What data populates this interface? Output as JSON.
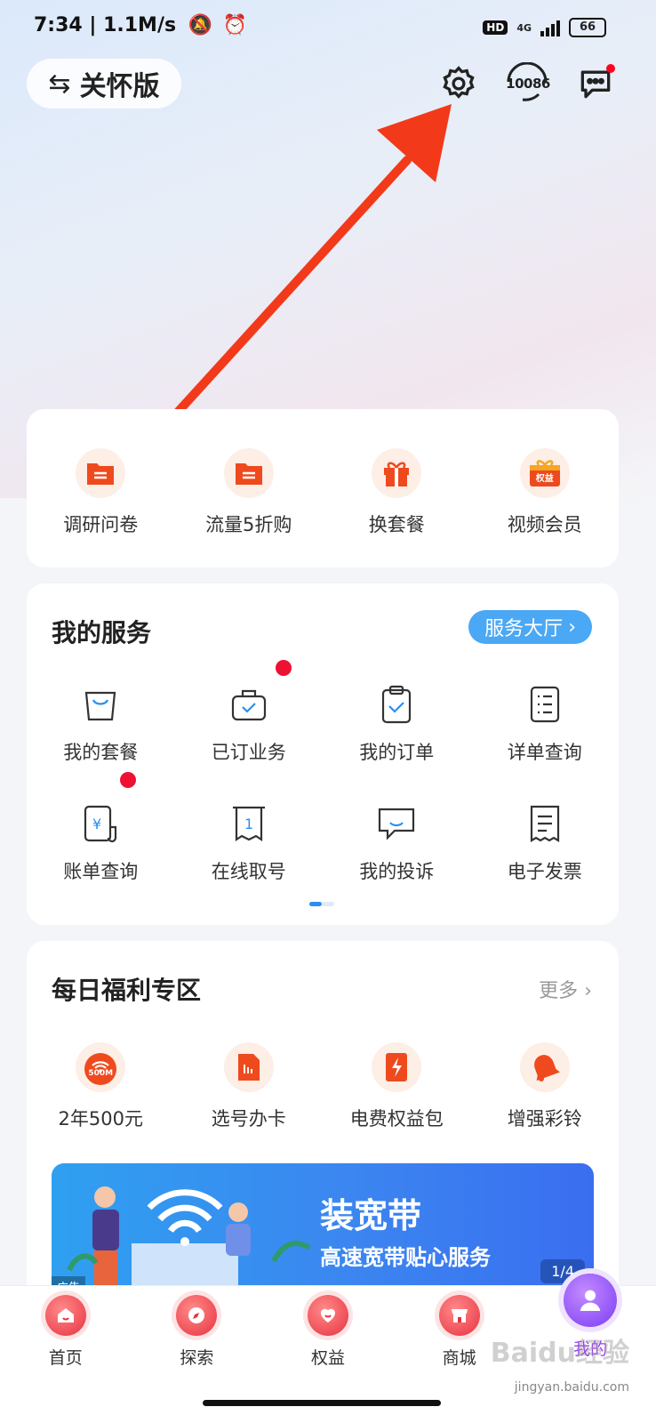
{
  "status_bar": {
    "time_speed": "7:34 | 1.1M/s",
    "network": "4G",
    "hd": "HD",
    "battery": "66"
  },
  "header": {
    "care_mode_label": "关怀版",
    "hotline_label": "10086",
    "icons": [
      "settings-icon",
      "customer-service-icon",
      "message-icon"
    ]
  },
  "quick_actions": [
    {
      "label": "调研问卷",
      "icon": "folder-icon"
    },
    {
      "label": "流量5折购",
      "icon": "folder-icon"
    },
    {
      "label": "换套餐",
      "icon": "gift-icon"
    },
    {
      "label": "视频会员",
      "icon": "gift-box-icon",
      "badge": "权益"
    }
  ],
  "services": {
    "title": "我的服务",
    "hall_button": "服务大厅",
    "items": [
      {
        "label": "我的套餐",
        "icon": "bag-icon",
        "dot": false
      },
      {
        "label": "已订业务",
        "icon": "briefcase-check-icon",
        "dot": true
      },
      {
        "label": "我的订单",
        "icon": "clipboard-check-icon",
        "dot": false
      },
      {
        "label": "详单查询",
        "icon": "list-doc-icon",
        "dot": false
      },
      {
        "label": "账单查询",
        "icon": "bill-icon",
        "dot": true
      },
      {
        "label": "在线取号",
        "icon": "ticket-icon",
        "dot": false
      },
      {
        "label": "我的投诉",
        "icon": "chat-icon",
        "dot": false
      },
      {
        "label": "电子发票",
        "icon": "invoice-icon",
        "dot": false
      }
    ],
    "pager": {
      "pages": 2,
      "active": 0
    }
  },
  "welfare": {
    "title": "每日福利专区",
    "more": "更多",
    "items": [
      {
        "label": "2年500元",
        "icon": "wifi-icon",
        "badge": "500M"
      },
      {
        "label": "选号办卡",
        "icon": "sim-card-icon"
      },
      {
        "label": "电费权益包",
        "icon": "electric-icon"
      },
      {
        "label": "增强彩铃",
        "icon": "bell-icon"
      }
    ],
    "banner": {
      "title": "装宽带",
      "subtitle": "高速宽带贴心服务",
      "page": "1/4",
      "ad_tag": "广告"
    }
  },
  "tabs": [
    {
      "label": "首页",
      "icon": "home-icon"
    },
    {
      "label": "探索",
      "icon": "compass-icon"
    },
    {
      "label": "权益",
      "icon": "heart-icon"
    },
    {
      "label": "商城",
      "icon": "shop-icon"
    },
    {
      "label": "我的",
      "icon": "user-icon",
      "active": true
    }
  ],
  "watermark": {
    "logo": "Baidu经验",
    "url": "jingyan.baidu.com"
  },
  "colors": {
    "accent_blue": "#4aa8f5",
    "brand_red": "#e8323f",
    "arrow": "#f23a1a",
    "active_tab": "#9b3df5"
  }
}
